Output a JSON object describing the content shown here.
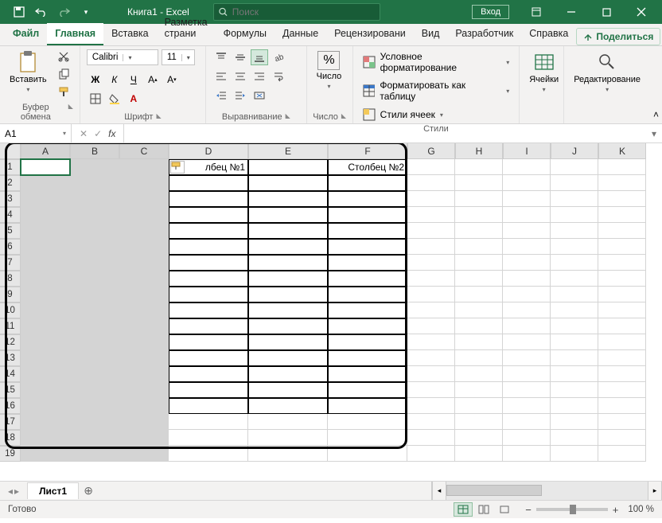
{
  "title": {
    "doc": "Книга1",
    "app": "Excel",
    "full": "Книга1  -  Excel"
  },
  "search": {
    "placeholder": "Поиск"
  },
  "signin": "Вход",
  "tabs": {
    "file": "Файл",
    "items": [
      "Главная",
      "Вставка",
      "Разметка страни",
      "Формулы",
      "Данные",
      "Рецензировани",
      "Вид",
      "Разработчик",
      "Справка"
    ],
    "active": 0,
    "share": "Поделиться"
  },
  "ribbon": {
    "clipboard": {
      "paste": "Вставить",
      "label": "Буфер обмена"
    },
    "font": {
      "name": "Calibri",
      "size": "11",
      "label": "Шрифт"
    },
    "align": {
      "label": "Выравнивание"
    },
    "number": {
      "big": "Число",
      "label": "Число"
    },
    "styles": {
      "cond": "Условное форматирование",
      "table": "Форматировать как таблицу",
      "cell": "Стили ячеек",
      "label": "Стили"
    },
    "cells": {
      "big": "Ячейки"
    },
    "editing": {
      "big": "Редактирование"
    }
  },
  "fx": {
    "name": "A1",
    "formula": ""
  },
  "grid": {
    "cols": [
      "A",
      "B",
      "C",
      "D",
      "E",
      "F",
      "G",
      "H",
      "I",
      "J",
      "K"
    ],
    "row_count": 19,
    "cell_d1": "лбец №1",
    "cell_f1": "Столбец №2"
  },
  "sheets": {
    "active": "Лист1"
  },
  "status": {
    "ready": "Готово",
    "zoom": "100 %"
  }
}
